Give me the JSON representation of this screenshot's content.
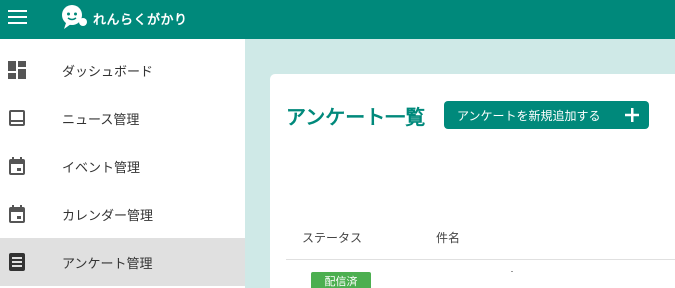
{
  "app": {
    "logo_text": "れんらくがかり",
    "brand_color": "#00897b"
  },
  "header": {
    "menu_icon": "hamburger-menu-icon"
  },
  "sidebar": {
    "items": [
      {
        "label": "ダッシュボード",
        "icon": "dashboard-icon",
        "active": false
      },
      {
        "label": "ニュース管理",
        "icon": "news-icon",
        "active": false
      },
      {
        "label": "イベント管理",
        "icon": "calendar-icon",
        "active": false
      },
      {
        "label": "カレンダー管理",
        "icon": "calendar-icon",
        "active": false
      },
      {
        "label": "アンケート管理",
        "icon": "list-icon",
        "active": true
      }
    ]
  },
  "main": {
    "title": "アンケート一覧",
    "add_button_label": "アンケートを新規追加する",
    "table": {
      "columns": [
        "ステータス",
        "件名"
      ],
      "rows": [
        {
          "status": "配信済",
          "status_color": "#4caf50"
        }
      ]
    }
  }
}
